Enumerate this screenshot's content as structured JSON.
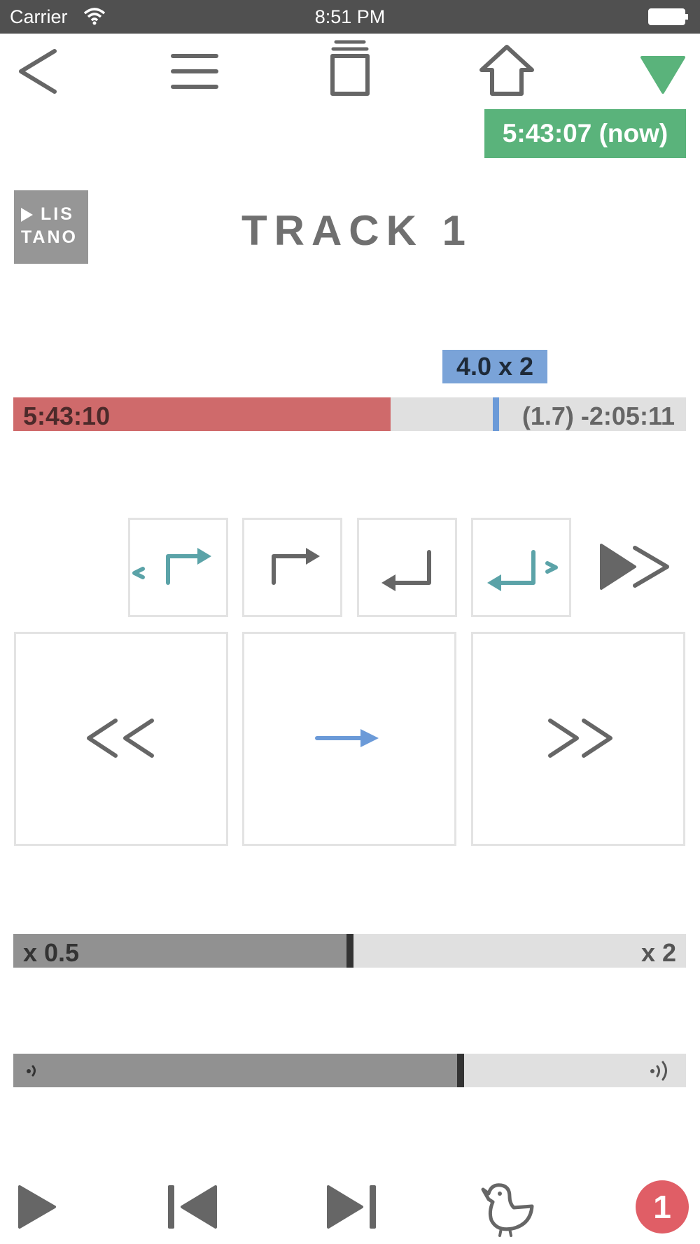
{
  "status_bar": {
    "carrier": "Carrier",
    "time": "8:51 PM"
  },
  "nav": {
    "icons": [
      "back-chevron-icon",
      "menu-icon",
      "clipboard-icon",
      "home-icon",
      "dropdown-triangle-icon"
    ],
    "now_button": "5:43:07 (now)",
    "accent": "#5ab37b"
  },
  "logo": {
    "line1": "LIS",
    "line2": "TANO"
  },
  "track": {
    "title": "TRACK 1"
  },
  "playback": {
    "speed_badge": "4.0 x 2",
    "elapsed": "5:43:10",
    "remaining": "(1.7) -2:05:11",
    "played_color": "#cf6a6b",
    "marker_color": "#6b9ad8"
  },
  "controls": {
    "small_row": [
      "loop-back-icon",
      "jump-forward-icon",
      "return-icon",
      "loop-forward-icon",
      "fast-forward-icon"
    ],
    "big_row": [
      "rewind-icon",
      "play-arrow-icon",
      "forward-icon"
    ]
  },
  "speed_slider": {
    "min_label": "x 0.5",
    "max_label": "x 2",
    "level": 0.5
  },
  "volume_slider": {
    "level": 0.66
  },
  "toolbar": {
    "icons": [
      "play-icon",
      "previous-track-icon",
      "next-track-icon",
      "bird-icon"
    ],
    "badge_count": "1",
    "badge_color": "#e05e66"
  }
}
